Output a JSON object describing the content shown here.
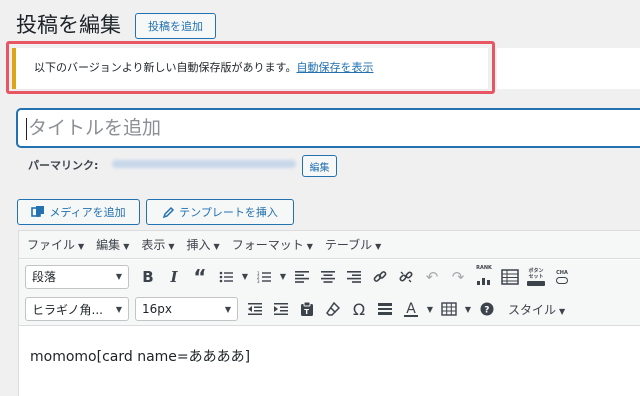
{
  "header": {
    "title": "投稿を編集",
    "add_new_label": "投稿を追加"
  },
  "notice": {
    "text": "以下のバージョンより新しい自動保存版があります。",
    "link": "自動保存を表示"
  },
  "title_field": {
    "placeholder": "タイトルを追加"
  },
  "permalink": {
    "label": "パーマリンク:",
    "edit_label": "編集"
  },
  "media_buttons": {
    "add_media": "メディアを追加",
    "template": "テンプレートを挿入"
  },
  "menubar": [
    "ファイル",
    "編集",
    "表示",
    "挿入",
    "フォーマット",
    "テーブル"
  ],
  "toolbar": {
    "format_select": "段落",
    "font_select": "ヒラギノ角...",
    "size_select": "16px",
    "style_label": "スタイル",
    "rank_label": "RANK",
    "button_label": "ボタン セット",
    "cha_label": "CHA"
  },
  "content": {
    "text": "momomo[card name=ああああ]"
  },
  "colors": {
    "accent": "#2271b1",
    "notice_border": "#dba617",
    "highlight": "#e85664"
  }
}
